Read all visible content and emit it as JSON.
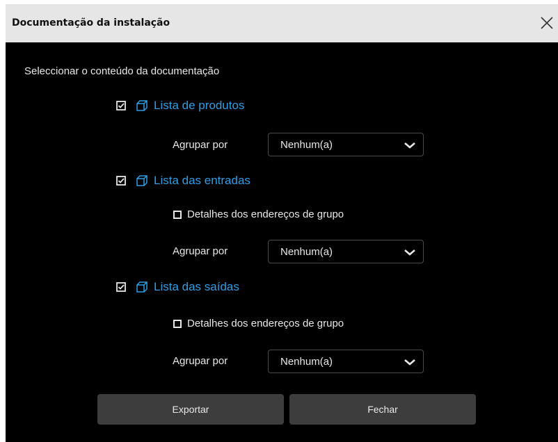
{
  "dialog": {
    "title": "Documentação da instalação",
    "heading": "Seleccionar o conteúdo da documentação"
  },
  "sections": [
    {
      "label": "Lista de produtos",
      "checked": true,
      "group_by_label": "Agrupar por",
      "group_by_value": "Nenhum(a)"
    },
    {
      "label": "Lista das entradas",
      "checked": true,
      "details_label": "Detalhes dos endereços de grupo",
      "details_checked": false,
      "group_by_label": "Agrupar por",
      "group_by_value": "Nenhum(a)"
    },
    {
      "label": "Lista das saídas",
      "checked": true,
      "details_label": "Detalhes dos endereços de grupo",
      "details_checked": false,
      "group_by_label": "Agrupar por",
      "group_by_value": "Nenhum(a)"
    }
  ],
  "buttons": {
    "export": "Exportar",
    "close": "Fechar"
  },
  "colors": {
    "accent": "#2f9ee4",
    "background": "#000000",
    "titlebar": "#e6e6e6",
    "button": "#3d3d3d"
  }
}
